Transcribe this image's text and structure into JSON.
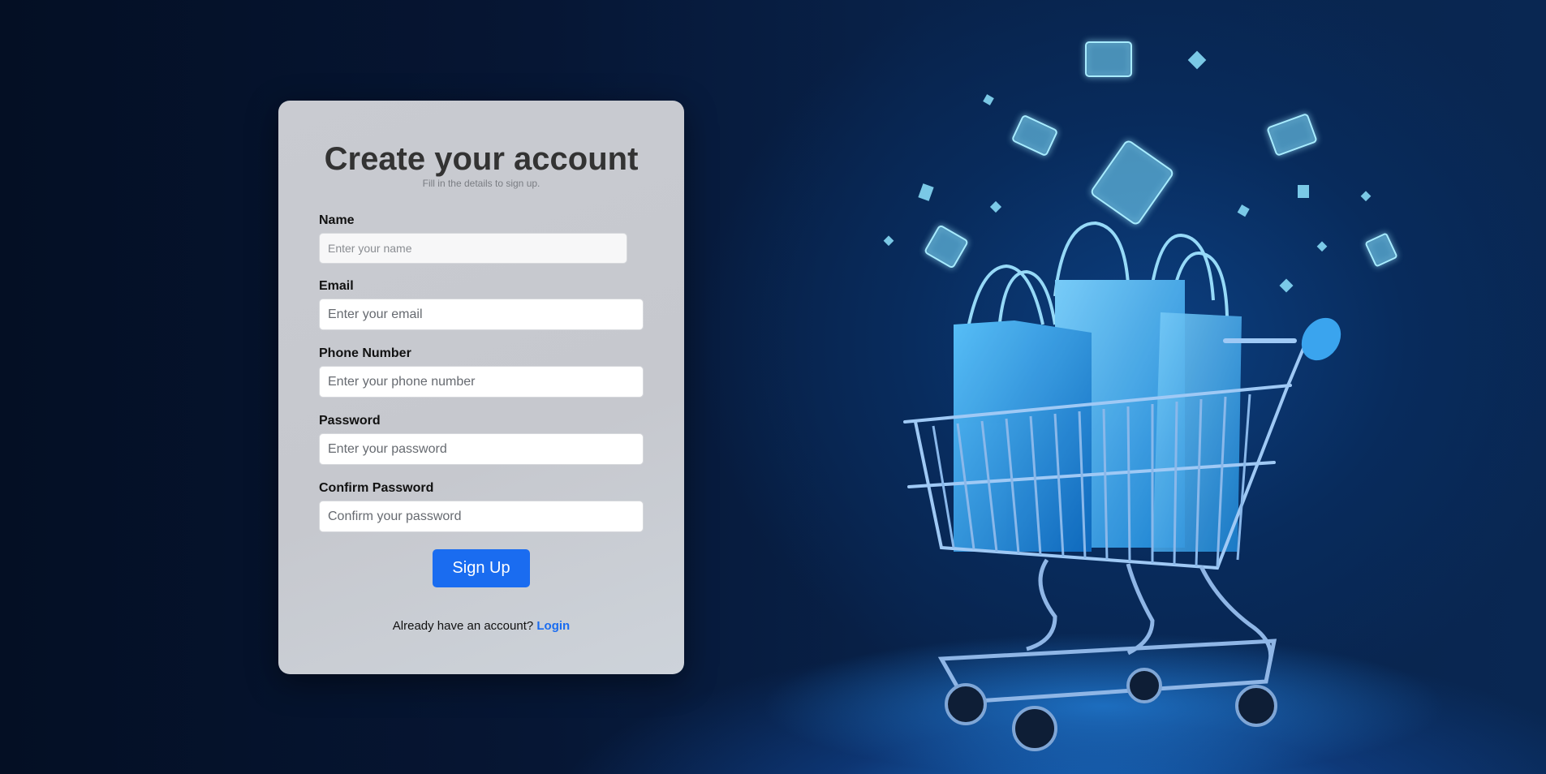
{
  "form": {
    "title": "Create your account",
    "subtitle": "Fill in the details to sign up.",
    "fields": [
      {
        "label": "Name",
        "placeholder": "Enter your name",
        "value": ""
      },
      {
        "label": "Email",
        "placeholder": "Enter your email",
        "value": ""
      },
      {
        "label": "Phone Number",
        "placeholder": "Enter your phone number",
        "value": ""
      },
      {
        "label": "Password",
        "placeholder": "Enter your password",
        "value": ""
      },
      {
        "label": "Confirm Password",
        "placeholder": "Confirm your password",
        "value": ""
      }
    ],
    "submit_label": "Sign Up",
    "login_prompt": "Already have an account?",
    "login_link": "Login"
  },
  "background": {
    "illustration": "shopping-cart-with-bags-and-floating-credit-cards",
    "accent_color": "#1a6cf0"
  }
}
